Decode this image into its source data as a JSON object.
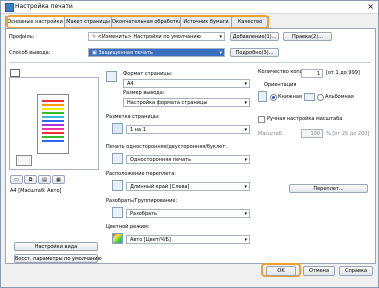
{
  "window": {
    "title": "Настройка печати"
  },
  "tabs": [
    "Основные настройки",
    "Макет страницы",
    "Окончательная обработка",
    "Источник бумаги",
    "Качество"
  ],
  "profile": {
    "label": "Профиль:",
    "value": "<Изменить> Настройки по умолчанию",
    "add_button": "Добавление(1)...",
    "edit_button": "Правка(2)..."
  },
  "output_method": {
    "label": "Способ вывода:",
    "value": "Защищенная печать",
    "details_button": "Подробно(3)..."
  },
  "preview": {
    "caption": "A4 [Масштаб: Авто]"
  },
  "left_buttons": {
    "view_settings": "Настройки вида",
    "restore_defaults": "Восст. параметры по умолчанию"
  },
  "page_format": {
    "label": "Формат страницы:",
    "value": "A4"
  },
  "output_size": {
    "label": "Размер вывода:",
    "value": "Настройка формата страницы"
  },
  "copies": {
    "label": "Количество копий:",
    "value": "1",
    "range": "[от 1 до 999]"
  },
  "orientation": {
    "label": "Ориентация",
    "portrait": "Книжная",
    "landscape": "Альбомная"
  },
  "page_layout": {
    "label": "Разметка страницы:",
    "value": "1 на 1"
  },
  "manual_scaling": {
    "label": "Ручная настройка масштаба",
    "scale_label": "Масштаб:",
    "value": "100",
    "range": "% [от 25 до 200]"
  },
  "duplex": {
    "label": "Печать односторонняя/двусторонняя/буклет:",
    "value": "Односторонняя печать"
  },
  "binding": {
    "label": "Расположение переплета:",
    "value": "Длинный край [Слева]",
    "gutter_button": "Переплет..."
  },
  "collate": {
    "label": "Разобрать/Группирование:",
    "value": "Разобрать"
  },
  "color_mode": {
    "label": "Цветной режим:",
    "value": "Авто [Цвет/Ч/Б]"
  },
  "footer": {
    "ok": "OK",
    "cancel": "Отмена",
    "help": "Справка"
  }
}
